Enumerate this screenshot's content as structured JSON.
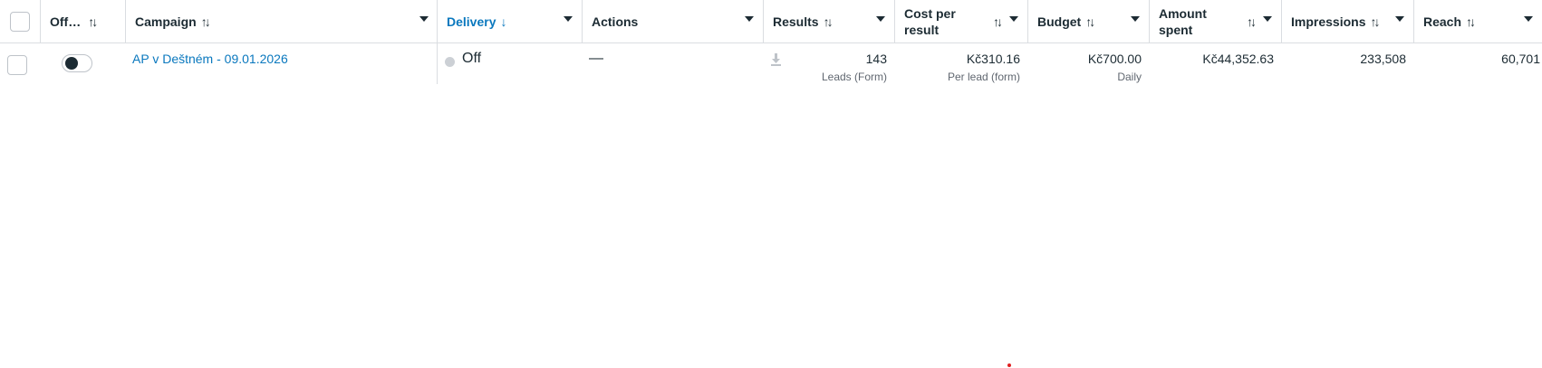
{
  "columns": {
    "off": "Off…",
    "campaign": "Campaign",
    "delivery": "Delivery",
    "actions": "Actions",
    "results": "Results",
    "cost_per_result": "Cost per result",
    "budget": "Budget",
    "amount_spent": "Amount spent",
    "impressions": "Impressions",
    "reach": "Reach"
  },
  "sort_icons": {
    "sortable": "↑↓",
    "descending": "↓"
  },
  "row": {
    "toggle_state": "off",
    "campaign": "AP v Deštném - 09.01.2026",
    "delivery": "Off",
    "actions": "—",
    "results": {
      "value": "143",
      "sub": "Leads (Form)"
    },
    "cost_per_result": {
      "value": "Kč310.16",
      "sub": "Per lead (form)"
    },
    "budget": {
      "value": "Kč700.00",
      "sub": "Daily"
    },
    "amount_spent": "Kč44,352.63",
    "impressions": "233,508",
    "reach": "60,701"
  },
  "colors": {
    "link": "#0a78be",
    "border": "#dadde1",
    "text": "#1c2b33",
    "muted": "#606770"
  },
  "icons": [
    "checkbox",
    "sort-icon",
    "caret-down-icon",
    "status-dot-icon",
    "download-icon",
    "toggle-switch"
  ]
}
